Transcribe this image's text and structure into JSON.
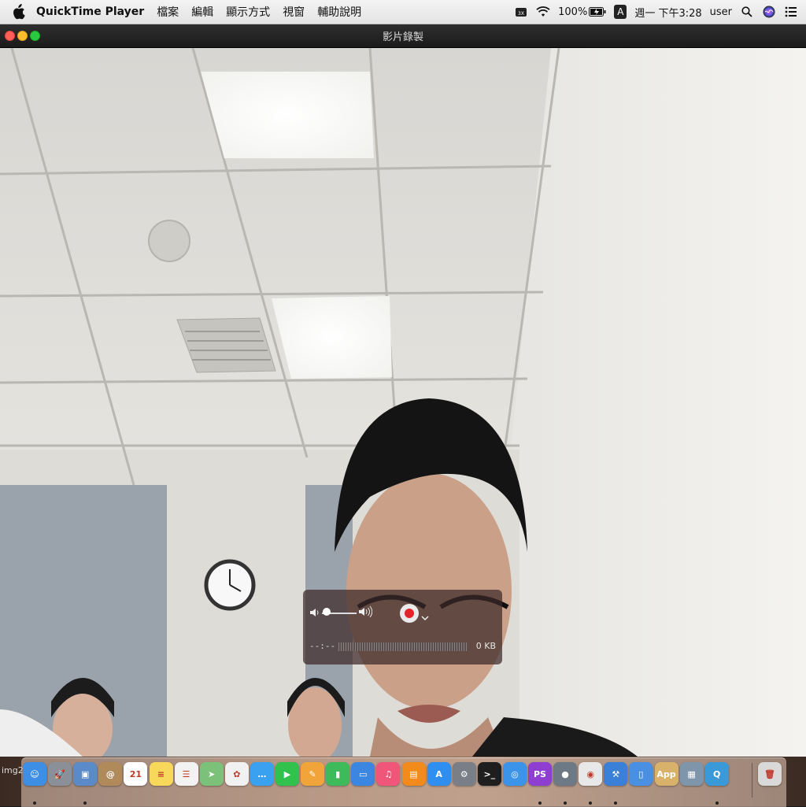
{
  "menubar": {
    "app_name": "QuickTime Player",
    "menus": [
      "檔案",
      "編輯",
      "顯示方式",
      "視窗",
      "輔助說明"
    ],
    "status": {
      "battery": "100%",
      "input_source": "A",
      "clock": "週一 下午3:28",
      "user": "user"
    }
  },
  "window": {
    "title": "影片錄製"
  },
  "hud": {
    "elapsed": "--:--",
    "file_size": "0 KB",
    "volume_level": 0.05
  },
  "desktop": {
    "label": "img2"
  },
  "dock": {
    "items": [
      {
        "name": "Finder",
        "icon": "finder-icon",
        "color": "#3d8fe6",
        "glyph": "☺",
        "running": true
      },
      {
        "name": "Launchpad",
        "icon": "launchpad-icon",
        "color": "#8a8f98",
        "glyph": "🚀",
        "running": false
      },
      {
        "name": "Preview",
        "icon": "preview-icon",
        "color": "#5b8ac9",
        "glyph": "▣",
        "running": true
      },
      {
        "name": "Contacts",
        "icon": "contacts-icon",
        "color": "#b08a5a",
        "glyph": "@",
        "running": false
      },
      {
        "name": "Calendar",
        "icon": "calendar-icon",
        "color": "#ffffff",
        "glyph": "21",
        "running": false
      },
      {
        "name": "Notes",
        "icon": "notes-icon",
        "color": "#f7d85a",
        "glyph": "≡",
        "running": false
      },
      {
        "name": "Reminders",
        "icon": "reminders-icon",
        "color": "#f2f2f2",
        "glyph": "☰",
        "running": false
      },
      {
        "name": "Maps",
        "icon": "maps-icon",
        "color": "#7cc17a",
        "glyph": "➤",
        "running": false
      },
      {
        "name": "Photos",
        "icon": "photos-icon",
        "color": "#f1f1f1",
        "glyph": "✿",
        "running": false
      },
      {
        "name": "Messages",
        "icon": "messages-icon",
        "color": "#3aa0f0",
        "glyph": "…",
        "running": false
      },
      {
        "name": "FaceTime",
        "icon": "facetime-icon",
        "color": "#31c24d",
        "glyph": "▶",
        "running": false
      },
      {
        "name": "Pages",
        "icon": "pages-icon",
        "color": "#f0a43a",
        "glyph": "✎",
        "running": false
      },
      {
        "name": "Numbers",
        "icon": "numbers-icon",
        "color": "#3dbb5b",
        "glyph": "▮",
        "running": false
      },
      {
        "name": "Keynote",
        "icon": "keynote-icon",
        "color": "#3a86e0",
        "glyph": "▭",
        "running": false
      },
      {
        "name": "iTunes",
        "icon": "itunes-icon",
        "color": "#f0557a",
        "glyph": "♫",
        "running": false
      },
      {
        "name": "iBooks",
        "icon": "ibooks-icon",
        "color": "#f28a1c",
        "glyph": "▤",
        "running": false
      },
      {
        "name": "App Store",
        "icon": "app-store-icon",
        "color": "#2f8ff0",
        "glyph": "A",
        "running": false
      },
      {
        "name": "System Preferences",
        "icon": "system-preferences-icon",
        "color": "#7a7f87",
        "glyph": "⚙",
        "running": false
      },
      {
        "name": "Terminal",
        "icon": "terminal-icon",
        "color": "#1e1e1e",
        "glyph": ">_",
        "running": false
      },
      {
        "name": "Safari",
        "icon": "safari-icon",
        "color": "#3b93ea",
        "glyph": "◎",
        "running": false
      },
      {
        "name": "PhpStorm",
        "icon": "phpstorm-icon",
        "color": "#8e3fd1",
        "glyph": "PS",
        "running": true
      },
      {
        "name": "Sequel Pro",
        "icon": "sequel-pro-icon",
        "color": "#6d7a85",
        "glyph": "●",
        "running": true
      },
      {
        "name": "Chrome",
        "icon": "chrome-icon",
        "color": "#e8e8e8",
        "glyph": "◉",
        "running": true
      },
      {
        "name": "Xcode",
        "icon": "xcode-icon",
        "color": "#3a7fd8",
        "glyph": "⚒",
        "running": true
      },
      {
        "name": "Simulator",
        "icon": "simulator-icon",
        "color": "#4a90e2",
        "glyph": "▯",
        "running": false
      },
      {
        "name": "Application Loader",
        "icon": "application-loader-icon",
        "color": "#d8b26a",
        "glyph": "App",
        "running": false
      },
      {
        "name": "Image Capture",
        "icon": "image-capture-icon",
        "color": "#7f95aa",
        "glyph": "▦",
        "running": false
      },
      {
        "name": "QuickTime Player",
        "icon": "quicktime-icon",
        "color": "#3a9ad9",
        "glyph": "Q",
        "running": true
      },
      {
        "name": "Trash",
        "icon": "trash-icon",
        "color": "#d9d9d9",
        "glyph": "🗑",
        "running": false
      }
    ]
  }
}
